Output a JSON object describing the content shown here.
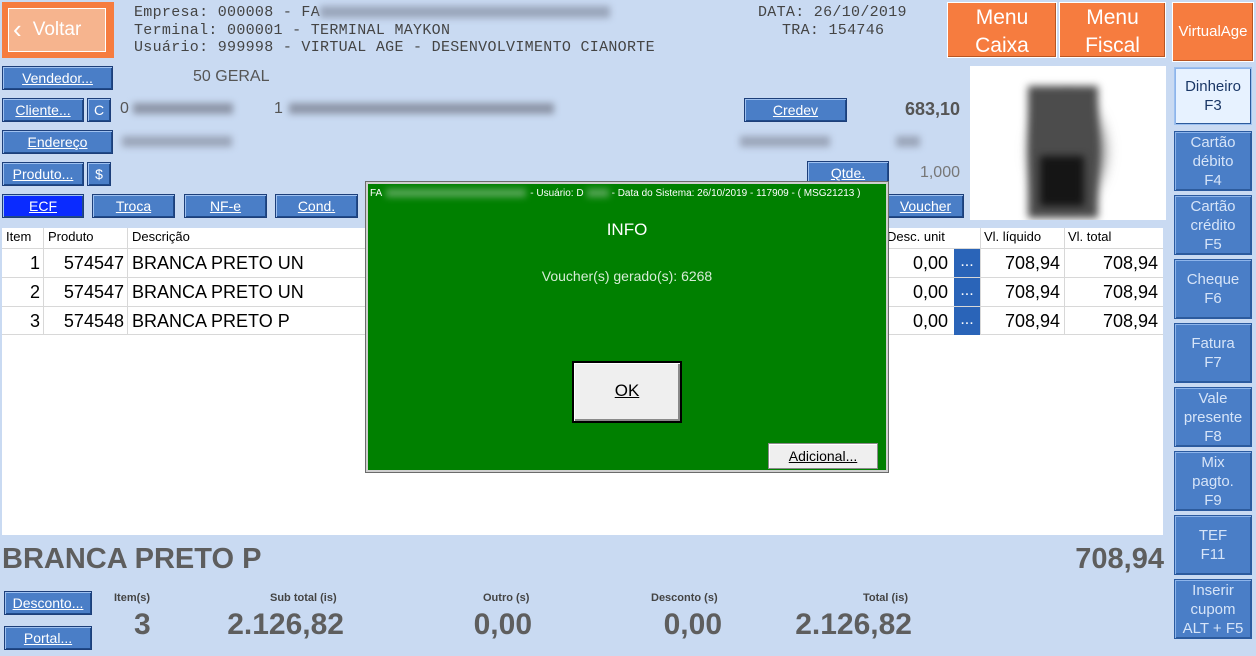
{
  "header": {
    "back_label": "Voltar",
    "empresa": "Empresa: 000008 - FA",
    "empresa_hidden": "FA",
    "terminal": "Terminal: 000001 - TERMINAL MAYKON",
    "usuario": "Usuário: 999998 - VIRTUAL AGE - DESENVOLVIMENTO CIANORTE",
    "data": "DATA: 26/10/2019",
    "tra": "TRA: 154746",
    "menu_caixa": "Menu Caixa",
    "menu_fiscal": "Menu Fiscal",
    "virtualage": "VirtualAge"
  },
  "customer": {
    "vendedor_label": "Vendedor...",
    "vendedor_value": "50 GERAL",
    "cliente_label": "Cliente...",
    "cliente_c": "C",
    "cliente_code": "0",
    "cliente_name": "1",
    "credev_label": "Credev",
    "credev_value": "683,10",
    "endereco_label": "Endereço",
    "produto_label": "Produto...",
    "produto_dollar": "$",
    "qtde_label": "Qtde.",
    "qtde_value": "1,000"
  },
  "toolbar": {
    "ecf": "ECF",
    "troca": "Troca",
    "nfe": "NF-e",
    "cond": "Cond.",
    "voucher": "Voucher"
  },
  "grid": {
    "columns": [
      "Item",
      "Produto",
      "Descrição",
      "Desc. unit",
      "Vl. líquido",
      "Vl. total"
    ],
    "rows": [
      {
        "item": "1",
        "produto": "574547",
        "descricao": "BRANCA PRETO UN",
        "desc_unit": "0,00",
        "vl_liquido": "708,94",
        "vl_total": "708,94"
      },
      {
        "item": "2",
        "produto": "574547",
        "descricao": "BRANCA PRETO UN",
        "desc_unit": "0,00",
        "vl_liquido": "708,94",
        "vl_total": "708,94"
      },
      {
        "item": "3",
        "produto": "574548",
        "descricao": "BRANCA PRETO P",
        "desc_unit": "0,00",
        "vl_liquido": "708,94",
        "vl_total": "708,94"
      }
    ],
    "dots_label": "..."
  },
  "current_item": {
    "name": "BRANCA PRETO P",
    "value": "708,94"
  },
  "footer": {
    "desconto_btn": "Desconto...",
    "portal_btn": "Portal...",
    "itens_label": "Item(s)",
    "itens_value": "3",
    "subtotal_label": "Sub total (is)",
    "subtotal_value": "2.126,82",
    "outro_label": "Outro (s)",
    "outro_value": "0,00",
    "desconto_label": "Desconto (s)",
    "desconto_value": "0,00",
    "total_label": "Total (is)",
    "total_value": "2.126,82"
  },
  "payments": [
    {
      "label": "Dinheiro F3"
    },
    {
      "label": "Cartão débito F4"
    },
    {
      "label": "Cartão crédito F5"
    },
    {
      "label": "Cheque F6"
    },
    {
      "label": "Fatura F7"
    },
    {
      "label": "Vale presente F8"
    },
    {
      "label": "Mix pagto. F9"
    },
    {
      "label": "TEF F11"
    },
    {
      "label": "Inserir cupom ALT + F5"
    }
  ],
  "dialog": {
    "title_prefix": "FA",
    "title_rest": "- Usuário: D",
    "title_tail": "- Data do Sistema: 26/10/2019 - 117909 - ( MSG21213 )",
    "heading": "INFO",
    "message": "Voucher(s) gerado(s): 6268",
    "ok": "OK",
    "adicional": "Adicional..."
  },
  "colors": {
    "background": "#c9daf2",
    "accent_orange": "#f67c3f",
    "button_blue": "#4a7ec7",
    "dialog_green": "#008000"
  }
}
